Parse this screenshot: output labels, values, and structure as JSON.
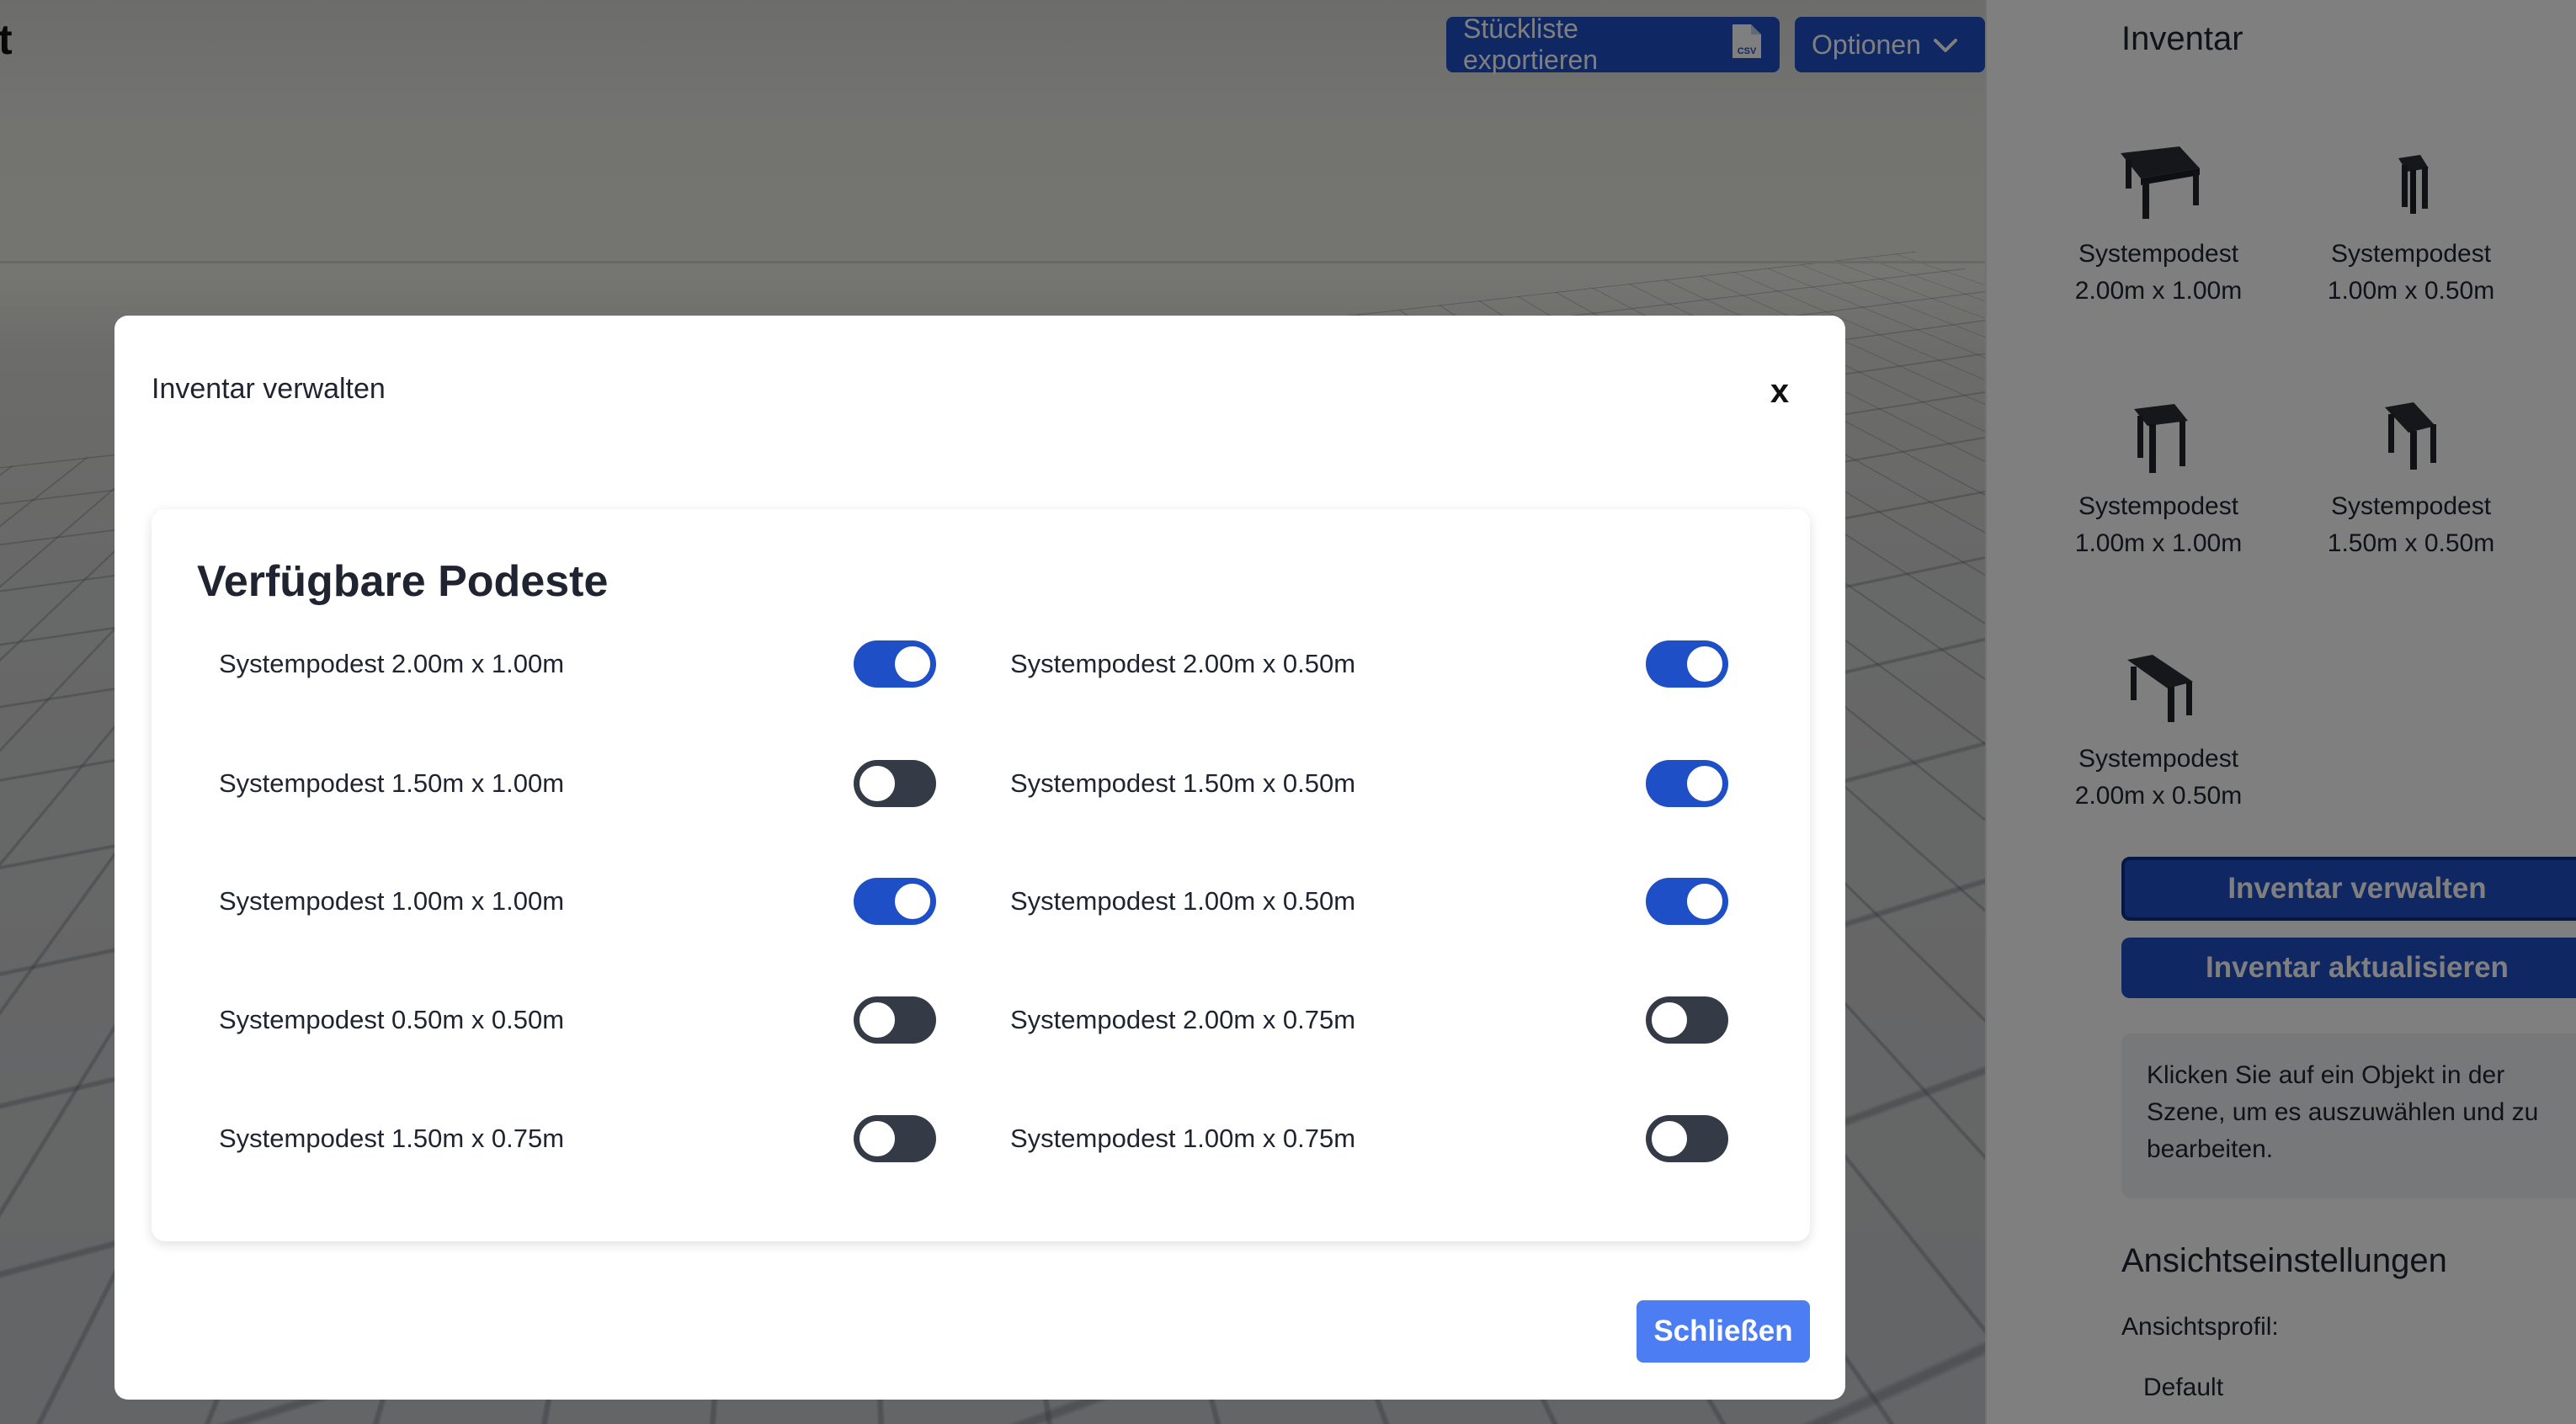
{
  "app": {
    "title_fragment": "t"
  },
  "toolbar": {
    "export_label": "Stückliste exportieren",
    "export_icon": "csv-file-icon",
    "options_label": "Optionen",
    "options_icon": "chevron-down-icon"
  },
  "sidebar": {
    "heading": "Inventar",
    "items": [
      {
        "line1": "Systempodest",
        "line2": "2.00m x 1.00m"
      },
      {
        "line1": "Systempodest",
        "line2": "1.00m x 0.50m"
      },
      {
        "line1": "Systempodest",
        "line2": "1.00m x 1.00m"
      },
      {
        "line1": "Systempodest",
        "line2": "1.50m x 0.50m"
      },
      {
        "line1": "Systempodest",
        "line2": "2.00m x 0.50m"
      }
    ],
    "manage_button": "Inventar verwalten",
    "update_button": "Inventar aktualisieren",
    "info_text": "Klicken Sie auf ein Objekt in der Szene, um es auszuwählen und zu bearbeiten.",
    "view_settings_heading": "Ansichtseinstellungen",
    "profile_label": "Ansichtsprofil:",
    "profile_value": "Default"
  },
  "modal": {
    "title": "Inventar verwalten",
    "close_glyph": "x",
    "card_title": "Verfügbare Podeste",
    "close_button": "Schließen",
    "left_column": [
      {
        "label": "Systempodest 2.00m x 1.00m",
        "enabled": true
      },
      {
        "label": "Systempodest 1.50m x 1.00m",
        "enabled": false
      },
      {
        "label": "Systempodest 1.00m x 1.00m",
        "enabled": true
      },
      {
        "label": "Systempodest 0.50m x 0.50m",
        "enabled": false
      },
      {
        "label": "Systempodest 1.50m x 0.75m",
        "enabled": false
      }
    ],
    "right_column": [
      {
        "label": "Systempodest 2.00m x 0.50m",
        "enabled": true
      },
      {
        "label": "Systempodest 1.50m x 0.50m",
        "enabled": true
      },
      {
        "label": "Systempodest 1.00m x 0.50m",
        "enabled": true
      },
      {
        "label": "Systempodest 2.00m x 0.75m",
        "enabled": false
      },
      {
        "label": "Systempodest 1.00m x 0.75m",
        "enabled": false
      }
    ]
  },
  "colors": {
    "primary": "#1e4fc6",
    "primary_light": "#4c7df2",
    "toggle_off": "#343b47"
  }
}
